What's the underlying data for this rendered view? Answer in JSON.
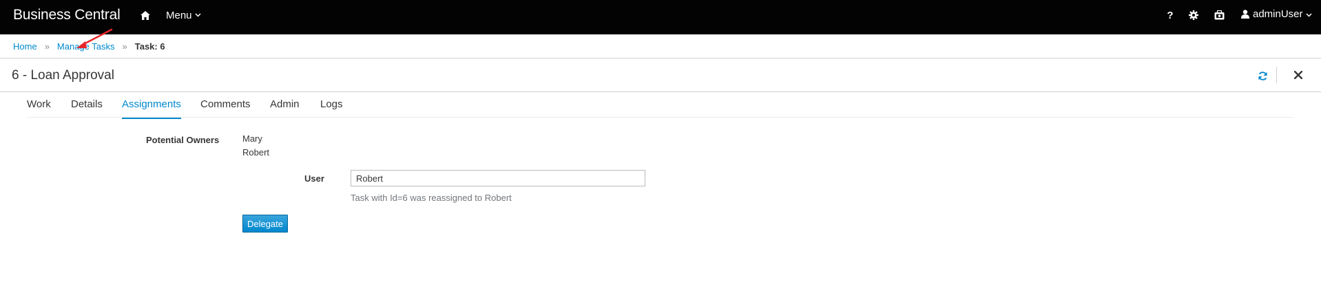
{
  "topbar": {
    "brand": "Business Central",
    "menu_label": "Menu",
    "help_glyph": "?",
    "user_label": "adminUser",
    "icons": [
      "home-icon",
      "question-icon",
      "gear-icon",
      "briefcase-icon",
      "user-icon",
      "chevron-down-icon"
    ]
  },
  "breadcrumb": {
    "items": [
      "Home",
      "Manage Tasks"
    ],
    "separator": "»",
    "current": "Task: 6"
  },
  "page": {
    "title": "6 - Loan Approval"
  },
  "tabs": [
    {
      "label": "Work",
      "active": false
    },
    {
      "label": "Details",
      "active": false
    },
    {
      "label": "Assignments",
      "active": true
    },
    {
      "label": "Comments",
      "active": false
    },
    {
      "label": "Admin",
      "active": false
    },
    {
      "label": "Logs",
      "active": false
    }
  ],
  "assignments": {
    "owners_label": "Potential Owners",
    "owners": [
      "Mary",
      "Robert"
    ],
    "user_label": "User",
    "user_value": "Robert",
    "help_text": "Task with Id=6 was reassigned to Robert",
    "delegate_label": "Delegate"
  },
  "colors": {
    "topbar_bg": "#030303",
    "link": "#0088ce",
    "primary_button": "#39a5dc",
    "annotation_arrow": "#e8262a"
  }
}
